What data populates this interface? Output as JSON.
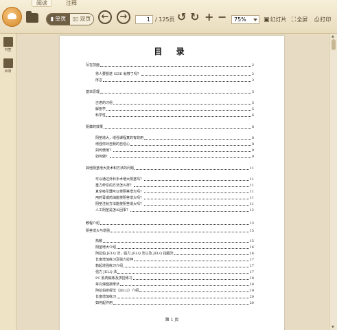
{
  "tabs": [
    "阅读",
    "注释"
  ],
  "toolbar": {
    "single_page": "单页",
    "double_page": "双页",
    "current_page": "1",
    "total_pages": "/ 125页",
    "zoom": "75%",
    "slideshow": "幻灯片",
    "fullscreen": "全屏",
    "print": "打印"
  },
  "sidebar": [
    {
      "label": "书签",
      "icon": "bookmark-icon"
    },
    {
      "label": "目录",
      "icon": "toc-icon"
    }
  ],
  "document": {
    "title": "目 录",
    "footer": "第 1 页",
    "toc": [
      {
        "level": 0,
        "text": "写在前面",
        "page": "2"
      },
      {
        "level": 1,
        "text": "男人要督遂 SIZE 就够了吗？",
        "page": "2"
      },
      {
        "level": 1,
        "text": "序言",
        "page": "3"
      },
      {
        "level": 0,
        "text": "基本原理",
        "page": "5"
      },
      {
        "level": 1,
        "text": "古老的习俗",
        "page": "5"
      },
      {
        "level": 1,
        "text": "解剖学",
        "page": "5"
      },
      {
        "level": 1,
        "text": "科学性",
        "page": "6"
      },
      {
        "level": 0,
        "text": "阴莽的效果",
        "page": "8"
      },
      {
        "level": 1,
        "text": "阴茎增大，增强课程真的有效用",
        "page": "8"
      },
      {
        "level": 1,
        "text": "增强你对自我的自信心",
        "page": "8"
      },
      {
        "level": 1,
        "text": "如何使用？",
        "page": "9"
      },
      {
        "level": 1,
        "text": "如何做？",
        "page": "9"
      },
      {
        "level": 0,
        "text": "其他阴茎增大技术和方法的问题",
        "page": "11"
      },
      {
        "level": 1,
        "text": "可以通过外科手术增大阴茎吗？",
        "page": "11"
      },
      {
        "level": 1,
        "text": "重力牵引的方法怎么样？",
        "page": "11"
      },
      {
        "level": 1,
        "text": "真空吸引器可以使阴茎增大吗？",
        "page": "11"
      },
      {
        "level": 1,
        "text": "用药膏或药油能使阴茎增大吗？",
        "page": "11"
      },
      {
        "level": 1,
        "text": "阴茎注射方法能使阴茎增大吗？",
        "page": "11"
      },
      {
        "level": 1,
        "text": "人工阴茎是怎么回事？",
        "page": "12"
      },
      {
        "level": 0,
        "text": "教程介绍",
        "page": "13"
      },
      {
        "level": 0,
        "text": "阴茎增大与增强",
        "page": "15"
      },
      {
        "level": 1,
        "text": "热敷",
        "page": "15"
      },
      {
        "level": 1,
        "text": "阴茎增大介绍",
        "page": "16"
      },
      {
        "level": 1,
        "text": "阿拉伯 JELQ 法，强力 JELQ 法以及 JELQ 指握法",
        "page": "16"
      },
      {
        "level": 1,
        "text": "长度增加练习及强力拉伸",
        "page": "17"
      },
      {
        "level": 1,
        "text": "勃起增强练习介绍",
        "page": "17"
      },
      {
        "level": 1,
        "text": "强力 JELQ 法",
        "page": "17"
      },
      {
        "level": 1,
        "text": "PC 肌肉锻炼及挤捏练习",
        "page": "18"
      },
      {
        "level": 1,
        "text": "睾丸保健按摩法",
        "page": "18"
      },
      {
        "level": 1,
        "text": "阿拉伯挤捏法（JELQ）介绍",
        "page": "19"
      },
      {
        "level": 1,
        "text": "长度增加练习",
        "page": "20"
      },
      {
        "level": 1,
        "text": "如何起作用",
        "page": "20"
      }
    ]
  }
}
